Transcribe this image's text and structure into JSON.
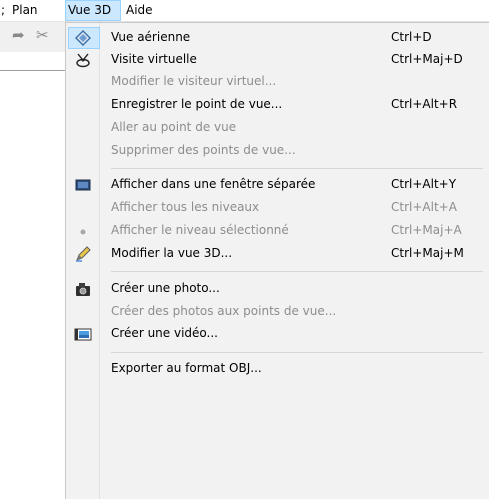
{
  "menubar": {
    "items": [
      {
        "label": ";"
      },
      {
        "label": "Plan"
      },
      {
        "label": "Vue 3D"
      },
      {
        "label": "Aide"
      }
    ]
  },
  "toolbar": {
    "icons": [
      "redo-icon",
      "cut-icon"
    ]
  },
  "menu": {
    "items": [
      {
        "label": "Vue aérienne",
        "shortcut": "Ctrl+D",
        "enabled": true,
        "icon": "aerial-view-icon"
      },
      {
        "label": "Visite virtuelle",
        "shortcut": "Ctrl+Maj+D",
        "enabled": true,
        "icon": "virtual-visitor-icon"
      },
      {
        "label": "Modifier le visiteur virtuel...",
        "shortcut": "",
        "enabled": false,
        "icon": ""
      },
      {
        "label": "Enregistrer le point de vue...",
        "shortcut": "Ctrl+Alt+R",
        "enabled": true,
        "icon": ""
      },
      {
        "label": "Aller au point de vue",
        "shortcut": "",
        "enabled": false,
        "icon": ""
      },
      {
        "label": "Supprimer des points de vue...",
        "shortcut": "",
        "enabled": false,
        "icon": ""
      },
      {
        "label": "Afficher dans une fenêtre séparée",
        "shortcut": "Ctrl+Alt+Y",
        "enabled": true,
        "icon": "window-icon"
      },
      {
        "label": "Afficher tous les niveaux",
        "shortcut": "Ctrl+Alt+A",
        "enabled": false,
        "icon": ""
      },
      {
        "label": "Afficher le niveau sélectionné",
        "shortcut": "Ctrl+Maj+A",
        "enabled": false,
        "icon": "radio-dot-icon"
      },
      {
        "label": "Modifier la vue 3D...",
        "shortcut": "Ctrl+Maj+M",
        "enabled": true,
        "icon": "pencil-icon"
      },
      {
        "label": "Créer une photo...",
        "shortcut": "",
        "enabled": true,
        "icon": "camera-icon"
      },
      {
        "label": "Créer des photos aux points de vue...",
        "shortcut": "",
        "enabled": false,
        "icon": ""
      },
      {
        "label": "Créer une vidéo...",
        "shortcut": "",
        "enabled": true,
        "icon": "video-icon"
      },
      {
        "label": "Exporter au format OBJ...",
        "shortcut": "",
        "enabled": true,
        "icon": ""
      }
    ]
  },
  "colors": {
    "highlight_fill": "#cce8ff",
    "highlight_border": "#99d1ff",
    "menu_background": "#f2f2f2",
    "disabled_text": "#8d8d8d"
  }
}
